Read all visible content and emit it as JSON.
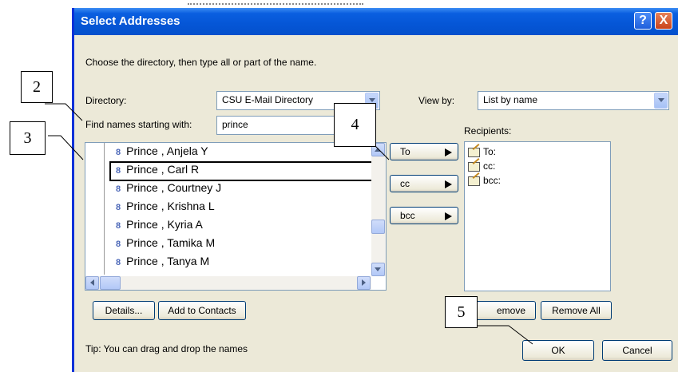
{
  "window": {
    "title": "Select Addresses",
    "help_glyph": "?",
    "close_glyph": "X"
  },
  "instructions": "Choose the directory, then type all or part of the name.",
  "directory": {
    "label": "Directory:",
    "value": "CSU E-Mail Directory"
  },
  "find": {
    "label": "Find names starting with:",
    "value": "prince"
  },
  "view_by": {
    "label": "View by:",
    "value": "List by name"
  },
  "names": [
    "Prince , Anjela Y",
    "Prince , Carl R",
    "Prince , Courtney J",
    "Prince , Krishna L",
    "Prince , Kyria A",
    "Prince , Tamika M",
    "Prince , Tanya M"
  ],
  "selected_name_index": 1,
  "person_icon_glyph": "8",
  "transfer_buttons": {
    "to": "To",
    "cc": "cc",
    "bcc": "bcc"
  },
  "recipients": {
    "label": "Recipients:",
    "items": [
      "To:",
      "cc:",
      "bcc:"
    ]
  },
  "buttons": {
    "details": "Details...",
    "add_to_contacts": "Add to Contacts",
    "remove": "emove",
    "remove_all": "Remove All",
    "ok": "OK",
    "cancel": "Cancel"
  },
  "tip": "Tip: You can drag and drop the names",
  "callouts": [
    "2",
    "3",
    "4",
    "5"
  ],
  "colors": {
    "titlebar": "#0556d6",
    "dialog_bg": "#ece9d8",
    "field_border": "#7f9db9"
  }
}
